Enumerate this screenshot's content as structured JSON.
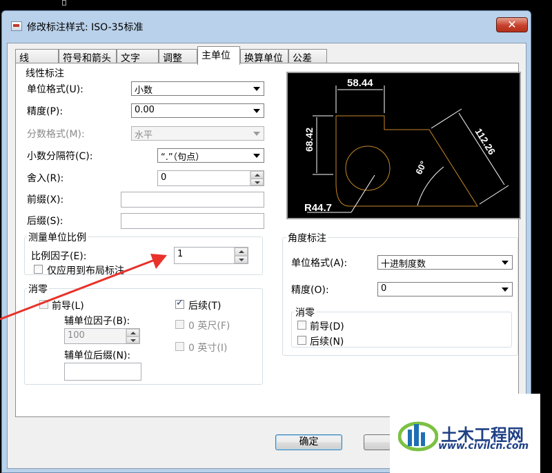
{
  "window": {
    "title": "修改标注样式: ISO-35标准",
    "close_label": "✕"
  },
  "tabs": [
    {
      "label": "线"
    },
    {
      "label": "符号和箭头"
    },
    {
      "label": "文字"
    },
    {
      "label": "调整"
    },
    {
      "label": "主单位",
      "active": true
    },
    {
      "label": "换算单位"
    },
    {
      "label": "公差"
    }
  ],
  "linear": {
    "title": "线性标注",
    "unit_format": {
      "label": "单位格式(U):",
      "value": "小数"
    },
    "precision": {
      "label": "精度(P):",
      "value": "0.00"
    },
    "fraction_format": {
      "label": "分数格式(M):",
      "value": "水平"
    },
    "decimal_separator": {
      "label": "小数分隔符(C):",
      "value": "“.”（句点）"
    },
    "round_off": {
      "label": "舍入(R):",
      "value": "0"
    },
    "prefix": {
      "label": "前缀(X):",
      "value": ""
    },
    "suffix": {
      "label": "后缀(S):",
      "value": ""
    }
  },
  "scale": {
    "title": "测量单位比例",
    "factor": {
      "label": "比例因子(E):",
      "value": "1"
    },
    "layout_only": {
      "label": "仅应用到布局标注",
      "checked": false
    }
  },
  "zero_suppression": {
    "title": "消零",
    "leading": {
      "label": "前导(L)",
      "checked": false
    },
    "trailing": {
      "label": "后续(T)",
      "checked": true
    },
    "sub_unit_factor": {
      "label": "辅单位因子(B):",
      "value": "100"
    },
    "sub_unit_suffix": {
      "label": "辅单位后缀(N):",
      "value": ""
    },
    "feet": {
      "label": "0 英尺(F)",
      "checked": false
    },
    "inches": {
      "label": "0 英寸(I)",
      "checked": false
    }
  },
  "preview": {
    "dims": [
      "58.44",
      "68.42",
      "112.26",
      "60°",
      "R44.7"
    ],
    "line_color": "#ffffff",
    "geometry_color": "#c8882a"
  },
  "angular": {
    "title": "角度标注",
    "unit_format": {
      "label": "单位格式(A):",
      "value": "十进制度数"
    },
    "precision": {
      "label": "精度(O):",
      "value": "0"
    },
    "zero_title": "消零",
    "leading": {
      "label": "前导(D)",
      "checked": false
    },
    "trailing": {
      "label": "后续(N)",
      "checked": false
    }
  },
  "buttons": {
    "ok": "确定"
  },
  "annotation": {
    "arrow_color": "#e8322a"
  },
  "watermark": {
    "name": "土木工程网",
    "url": "www.civilcn.com"
  }
}
